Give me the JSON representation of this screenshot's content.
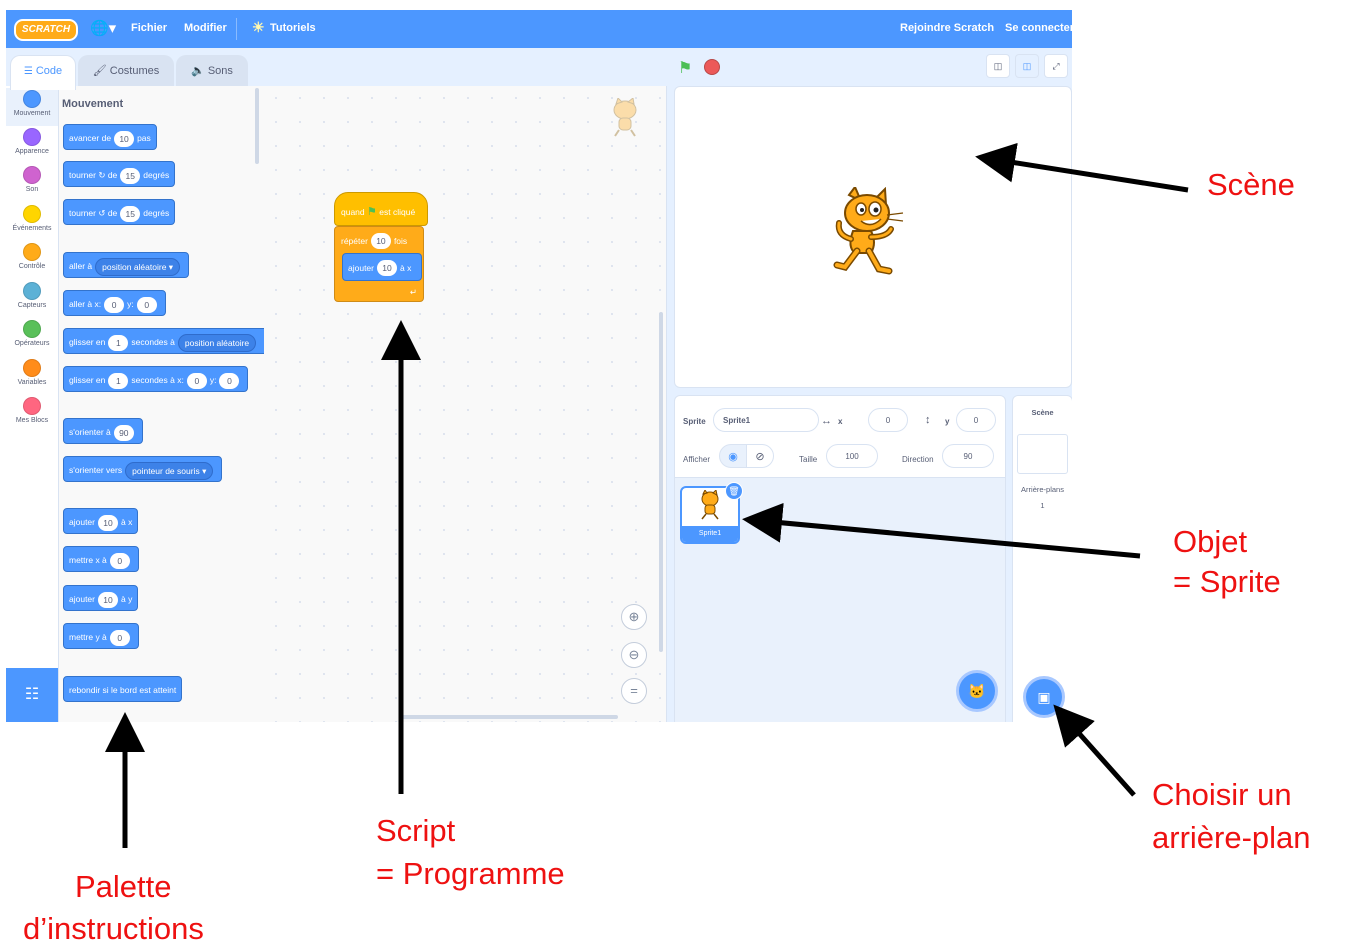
{
  "menu": {
    "logo": "SCRATCH",
    "file": "Fichier",
    "edit": "Modifier",
    "tutorials": "Tutoriels",
    "join": "Rejoindre Scratch",
    "signin": "Se connecter"
  },
  "tabs": {
    "code": "Code",
    "costumes": "Costumes",
    "sounds": "Sons"
  },
  "categories": [
    {
      "label": "Mouvement",
      "color": "#4c97ff"
    },
    {
      "label": "Apparence",
      "color": "#9966ff"
    },
    {
      "label": "Son",
      "color": "#cf63cf"
    },
    {
      "label": "Événements",
      "color": "#ffd500"
    },
    {
      "label": "Contrôle",
      "color": "#ffab19"
    },
    {
      "label": "Capteurs",
      "color": "#5cb1d6"
    },
    {
      "label": "Opérateurs",
      "color": "#59c059"
    },
    {
      "label": "Variables",
      "color": "#ff8c1a"
    },
    {
      "label": "Mes Blocs",
      "color": "#ff6680"
    }
  ],
  "palette": {
    "title": "Mouvement",
    "move": {
      "a": "avancer de",
      "v": "10",
      "b": "pas"
    },
    "turn_right": {
      "a": "tourner",
      "b": "de",
      "v": "15",
      "c": "degrés"
    },
    "turn_left": {
      "a": "tourner",
      "b": "de",
      "v": "15",
      "c": "degrés"
    },
    "goto": {
      "a": "aller à",
      "d": "position aléatoire"
    },
    "goto_xy": {
      "a": "aller à x:",
      "x": "0",
      "b": "y:",
      "y": "0"
    },
    "glide": {
      "a": "glisser en",
      "v": "1",
      "b": "secondes à",
      "d": "position aléatoire"
    },
    "glide_xy": {
      "a": "glisser en",
      "v": "1",
      "b": "secondes à x:",
      "x": "0",
      "c": "y:",
      "y": "0"
    },
    "point_dir": {
      "a": "s'orienter à",
      "v": "90"
    },
    "point_towards": {
      "a": "s'orienter vers",
      "d": "pointeur de souris"
    },
    "change_x": {
      "a": "ajouter",
      "v": "10",
      "b": "à x"
    },
    "set_x": {
      "a": "mettre x à",
      "v": "0"
    },
    "change_y": {
      "a": "ajouter",
      "v": "10",
      "b": "à y"
    },
    "set_y": {
      "a": "mettre y à",
      "v": "0"
    },
    "bounce": "rebondir si le bord est atteint"
  },
  "script": {
    "hat": {
      "a": "quand",
      "b": "est cliqué"
    },
    "repeat": {
      "a": "répéter",
      "v": "10",
      "b": "fois"
    },
    "inner": {
      "a": "ajouter",
      "v": "10",
      "b": "à x"
    }
  },
  "sprite_info": {
    "sprite_label": "Sprite",
    "sprite_name": "Sprite1",
    "x_label": "x",
    "x_value": "0",
    "y_label": "y",
    "y_value": "0",
    "show_label": "Afficher",
    "size_label": "Taille",
    "size_value": "100",
    "direction_label": "Direction",
    "direction_value": "90"
  },
  "sprite_list": [
    {
      "name": "Sprite1"
    }
  ],
  "stage_pane": {
    "title": "Scène",
    "backdrops_label": "Arrière-plans",
    "backdrops_count": "1"
  },
  "annotations": {
    "scene": "Scène",
    "object_1": "Objet",
    "object_2": "= Sprite",
    "backdrop_1": "Choisir un",
    "backdrop_2": "arrière-plan",
    "script_1": "Script",
    "script_2": "= Programme",
    "palette_1": "Palette",
    "palette_2": "d’instructions"
  }
}
